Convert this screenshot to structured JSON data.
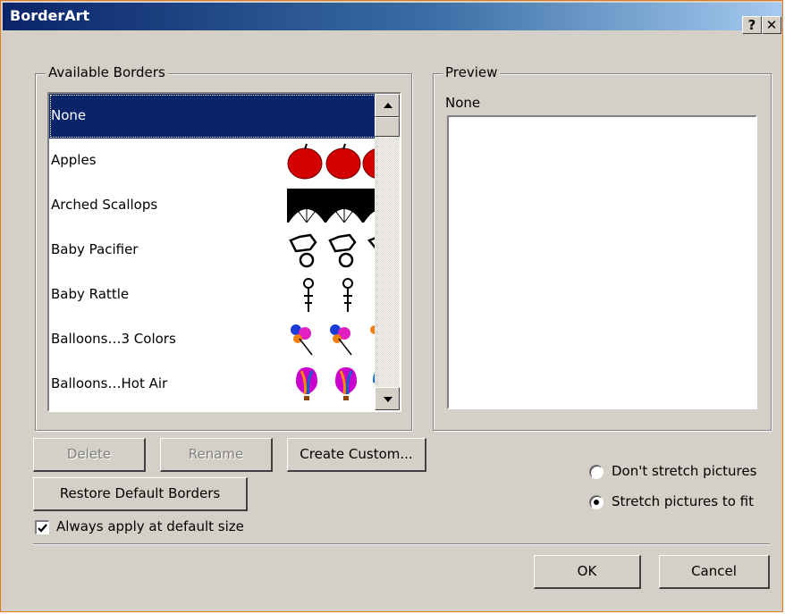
{
  "window": {
    "title": "BorderArt",
    "help_glyph": "?",
    "close_glyph": "✕"
  },
  "available": {
    "group_label": "Available Borders",
    "items": [
      {
        "label": "None",
        "selected": true,
        "art": ""
      },
      {
        "label": "Apples",
        "selected": false,
        "art": "apple"
      },
      {
        "label": "Arched Scallops",
        "selected": false,
        "art": "scallop"
      },
      {
        "label": "Baby Pacifier",
        "selected": false,
        "art": "pacifier"
      },
      {
        "label": "Baby Rattle",
        "selected": false,
        "art": "rattle"
      },
      {
        "label": "Balloons…3 Colors",
        "selected": false,
        "art": "balloons"
      },
      {
        "label": "Balloons…Hot Air",
        "selected": false,
        "art": "hotair"
      }
    ]
  },
  "preview": {
    "group_label": "Preview",
    "name": "None"
  },
  "buttons": {
    "delete": "Delete",
    "rename": "Rename",
    "create_custom": "Create Custom...",
    "restore_default": "Restore Default Borders",
    "ok": "OK",
    "cancel": "Cancel"
  },
  "options": {
    "always_apply_label": "Always apply at default size",
    "always_apply_checked": true,
    "dont_stretch_label": "Don't stretch pictures",
    "stretch_label": "Stretch pictures to fit",
    "stretch_selected": "stretch"
  },
  "colors": {
    "selection": "#0a246a",
    "dialog_face": "#d4d0c8",
    "apple_red": "#d40000"
  }
}
